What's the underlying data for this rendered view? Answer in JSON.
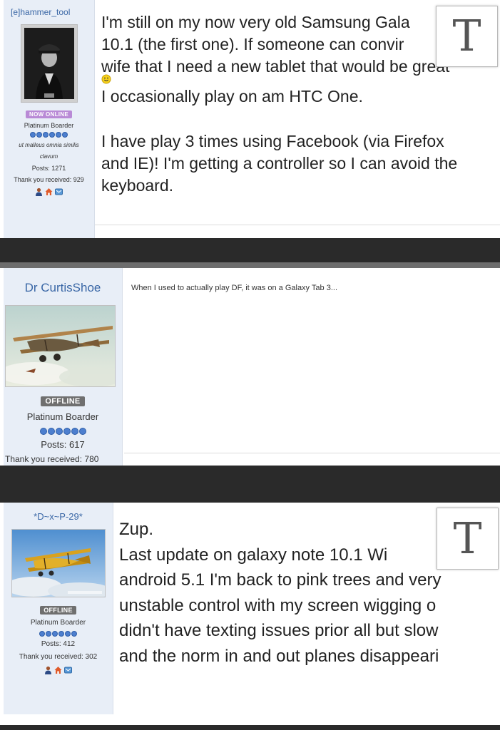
{
  "post1": {
    "username": "[e]hammer_tool",
    "status": "NOW ONLINE",
    "rank": "Platinum Boarder",
    "motto_line1": "ut malleus omnia similis",
    "motto_line2": "clavum",
    "posts": "Posts: 1271",
    "thanks": "Thank you received: 929",
    "icons": [
      "user-icon",
      "home-icon",
      "message-icon"
    ],
    "message": [
      "I'm still on my now very old Samsung Gala",
      "10.1 (the first one). If someone can convir",
      "wife that I need a new tablet that would be great",
      "",
      "I occasionally play on am HTC One.",
      "",
      "I have play 3 times using Facebook (via Firefox",
      "and IE)! I'm getting a controller so I can avoid the",
      "keyboard."
    ],
    "overlay_letter": "T"
  },
  "post2": {
    "username": "Dr CurtisShoe",
    "status": "OFFLINE",
    "rank": "Platinum Boarder",
    "posts": "Posts: 617",
    "thanks": "Thank you received: 780",
    "message": "When I used to actually play DF, it was on a Galaxy Tab 3..."
  },
  "post3": {
    "username": "*D~x~P-29*",
    "status": "OFFLINE",
    "rank": "Platinum Boarder",
    "posts": "Posts: 412",
    "thanks": "Thank you received: 302",
    "icons": [
      "user-icon",
      "home-icon",
      "message-icon"
    ],
    "message": [
      "Zup.",
      "Last update on galaxy note 10.1 Wi",
      "android 5.1 I'm back to pink trees and very",
      "unstable control with my screen wigging o",
      "didn't have texting issues prior all but slow",
      "and the norm in and out planes disappeari"
    ],
    "overlay_letter": "T"
  },
  "colors": {
    "online_badge": "#b98ad6",
    "offline_badge": "#6f6f6f",
    "rank_dot": "#4d7fcf",
    "username": "#3a67a6",
    "sidebar_bg": "#e8eef7"
  }
}
